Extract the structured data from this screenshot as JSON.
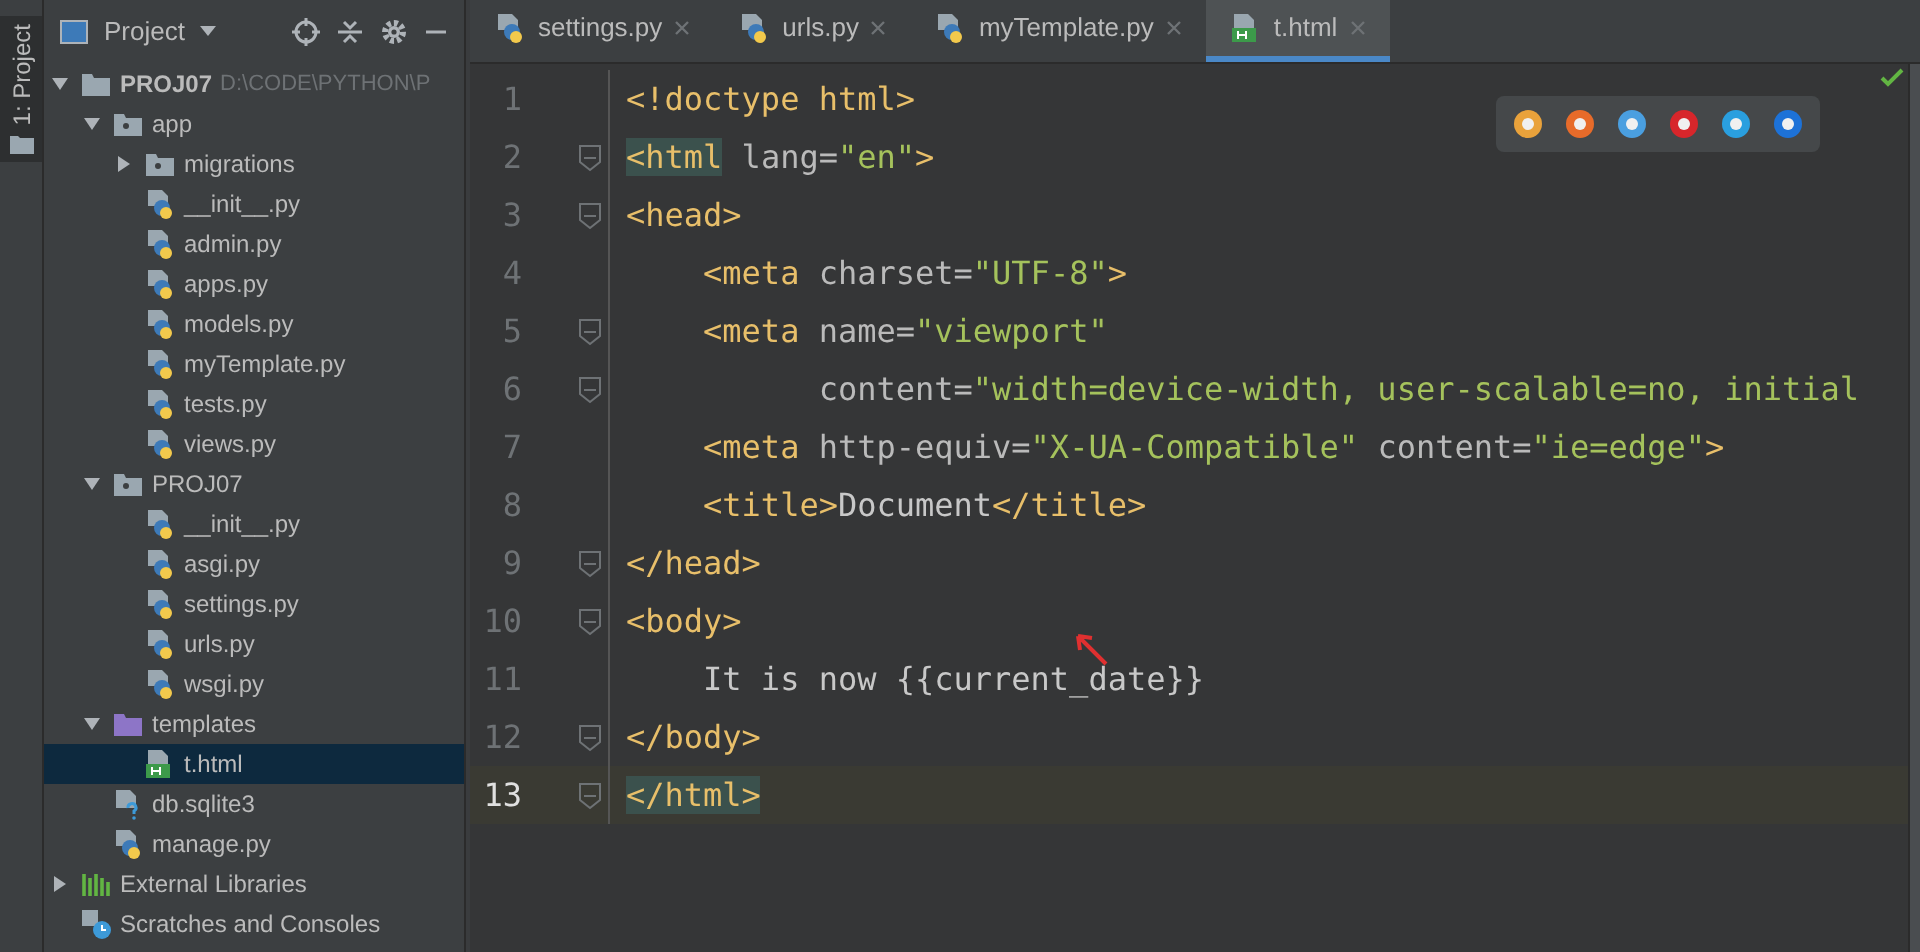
{
  "tool_strip": {
    "label": "1: Project"
  },
  "project_panel": {
    "title": "Project",
    "tree": [
      {
        "label": "PROJ07",
        "path": "D:\\CODE\\PYTHON\\P",
        "kind": "folder",
        "expanded": true,
        "selected": false,
        "children": [
          {
            "label": "app",
            "kind": "package",
            "expanded": true,
            "selected": false,
            "children": [
              {
                "label": "migrations",
                "kind": "package",
                "expanded": false,
                "selected": false
              },
              {
                "label": "__init__.py",
                "kind": "python",
                "selected": false
              },
              {
                "label": "admin.py",
                "kind": "python",
                "selected": false
              },
              {
                "label": "apps.py",
                "kind": "python",
                "selected": false
              },
              {
                "label": "models.py",
                "kind": "python",
                "selected": false
              },
              {
                "label": "myTemplate.py",
                "kind": "python",
                "selected": false
              },
              {
                "label": "tests.py",
                "kind": "python",
                "selected": false
              },
              {
                "label": "views.py",
                "kind": "python",
                "selected": false
              }
            ]
          },
          {
            "label": "PROJ07",
            "kind": "package",
            "expanded": true,
            "selected": false,
            "children": [
              {
                "label": "__init__.py",
                "kind": "python",
                "selected": false
              },
              {
                "label": "asgi.py",
                "kind": "python",
                "selected": false
              },
              {
                "label": "settings.py",
                "kind": "python",
                "selected": false
              },
              {
                "label": "urls.py",
                "kind": "python",
                "selected": false
              },
              {
                "label": "wsgi.py",
                "kind": "python",
                "selected": false
              }
            ]
          },
          {
            "label": "templates",
            "kind": "templates",
            "expanded": true,
            "selected": false,
            "children": [
              {
                "label": "t.html",
                "kind": "html",
                "selected": true
              }
            ]
          },
          {
            "label": "db.sqlite3",
            "kind": "unknown",
            "selected": false
          },
          {
            "label": "manage.py",
            "kind": "python",
            "selected": false
          }
        ]
      },
      {
        "label": "External Libraries",
        "kind": "libraries",
        "expanded": false,
        "selected": false
      },
      {
        "label": "Scratches and Consoles",
        "kind": "scratches",
        "selected": false
      }
    ]
  },
  "tabs": [
    {
      "label": "settings.py",
      "kind": "python",
      "selected": false
    },
    {
      "label": "urls.py",
      "kind": "python",
      "selected": false
    },
    {
      "label": "myTemplate.py",
      "kind": "python",
      "selected": false
    },
    {
      "label": "t.html",
      "kind": "html",
      "selected": true
    }
  ],
  "editor": {
    "lines": [
      {
        "number": "1",
        "fold": false,
        "current": false,
        "tokens": [
          {
            "kind": "tag",
            "text": "<!doctype html>"
          }
        ]
      },
      {
        "number": "2",
        "fold": true,
        "current": false,
        "tokens": [
          {
            "kind": "tag",
            "text": "<html",
            "match": true
          },
          {
            "kind": "attr",
            "text": " lang="
          },
          {
            "kind": "string",
            "text": "\"en\""
          },
          {
            "kind": "tag",
            "text": ">"
          }
        ]
      },
      {
        "number": "3",
        "fold": true,
        "current": false,
        "tokens": [
          {
            "kind": "tag",
            "text": "<head>"
          }
        ]
      },
      {
        "number": "4",
        "fold": false,
        "current": false,
        "tokens": [
          {
            "kind": "tag",
            "text": "    <meta"
          },
          {
            "kind": "attr",
            "text": " charset="
          },
          {
            "kind": "string",
            "text": "\"UTF-8\""
          },
          {
            "kind": "tag",
            "text": ">"
          }
        ]
      },
      {
        "number": "5",
        "fold": true,
        "current": false,
        "tokens": [
          {
            "kind": "tag",
            "text": "    <meta"
          },
          {
            "kind": "attr",
            "text": " name="
          },
          {
            "kind": "string",
            "text": "\"viewport\""
          }
        ]
      },
      {
        "number": "6",
        "fold": true,
        "current": false,
        "tokens": [
          {
            "kind": "attr",
            "text": "          content="
          },
          {
            "kind": "string",
            "text": "\"width=device-width, user-scalable=no, initial"
          }
        ]
      },
      {
        "number": "7",
        "fold": false,
        "current": false,
        "tokens": [
          {
            "kind": "tag",
            "text": "    <meta"
          },
          {
            "kind": "attr",
            "text": " http-equiv="
          },
          {
            "kind": "string",
            "text": "\"X-UA-Compatible\""
          },
          {
            "kind": "attr",
            "text": " content="
          },
          {
            "kind": "string",
            "text": "\"ie=edge\""
          },
          {
            "kind": "tag",
            "text": ">"
          }
        ]
      },
      {
        "number": "8",
        "fold": false,
        "current": false,
        "tokens": [
          {
            "kind": "tag",
            "text": "    <title>"
          },
          {
            "kind": "text",
            "text": "Document"
          },
          {
            "kind": "tag",
            "text": "</title>"
          }
        ]
      },
      {
        "number": "9",
        "fold": true,
        "current": false,
        "tokens": [
          {
            "kind": "tag",
            "text": "</head>"
          }
        ]
      },
      {
        "number": "10",
        "fold": true,
        "current": false,
        "tokens": [
          {
            "kind": "tag",
            "text": "<body>"
          }
        ]
      },
      {
        "number": "11",
        "fold": false,
        "current": false,
        "tokens": [
          {
            "kind": "text",
            "text": "    It is now {{current_date}}"
          }
        ]
      },
      {
        "number": "12",
        "fold": true,
        "current": false,
        "tokens": [
          {
            "kind": "tag",
            "text": "</body>"
          }
        ]
      },
      {
        "number": "13",
        "fold": true,
        "current": true,
        "tokens": [
          {
            "kind": "tag",
            "text": "</html>",
            "match": true
          }
        ]
      }
    ]
  }
}
